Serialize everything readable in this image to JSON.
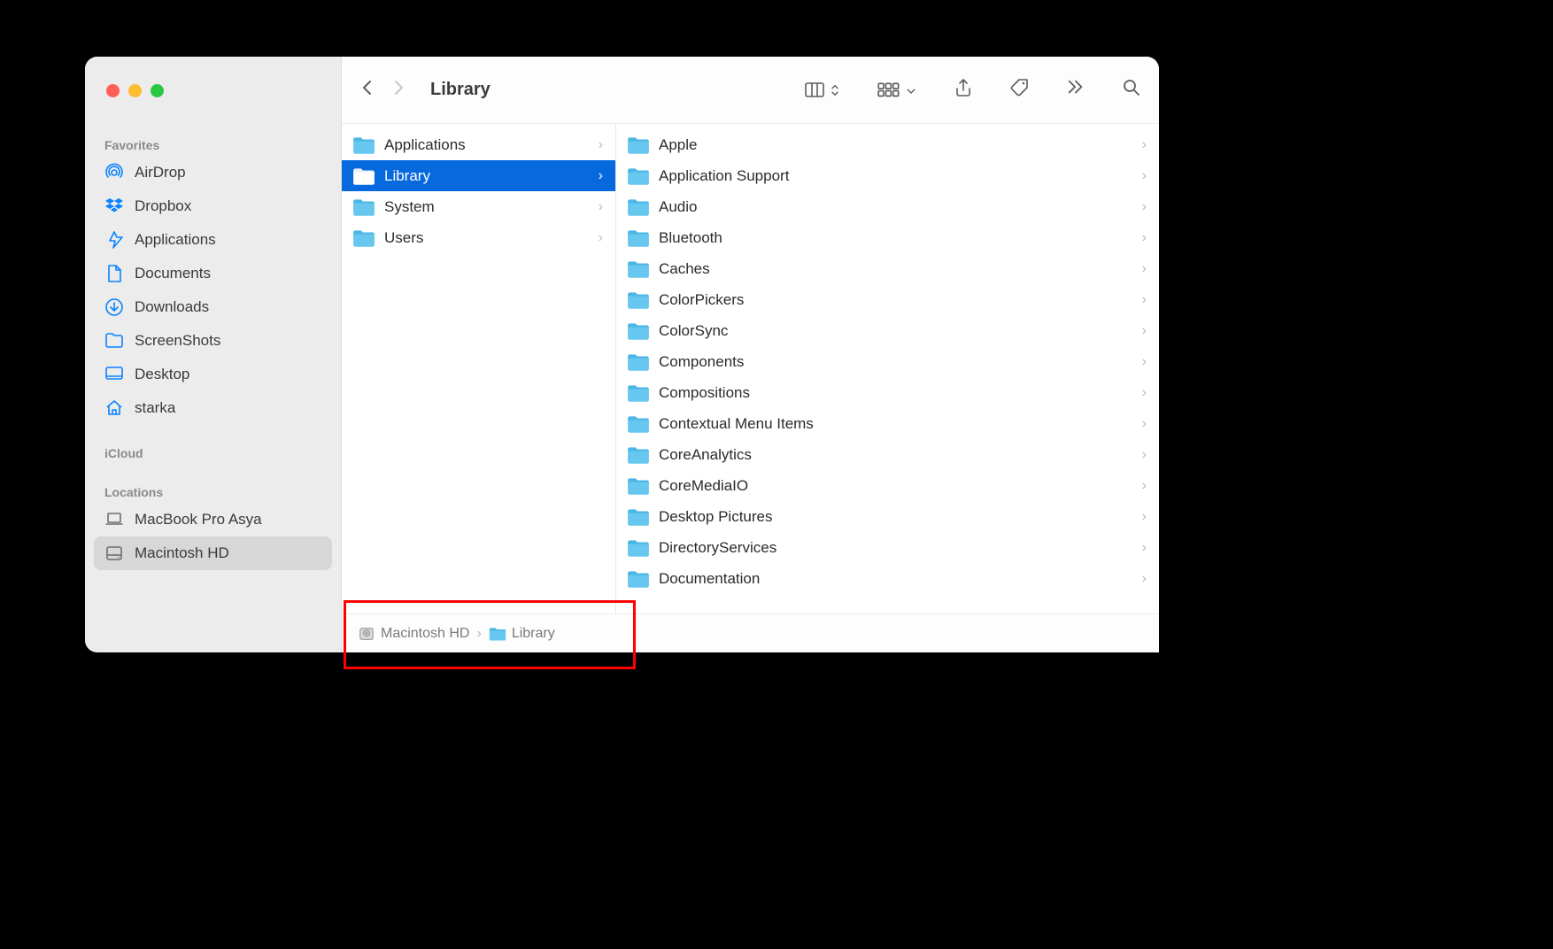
{
  "window": {
    "title": "Library"
  },
  "sidebar": {
    "sections": {
      "favorites": {
        "label": "Favorites",
        "items": [
          {
            "icon": "airdrop",
            "label": "AirDrop"
          },
          {
            "icon": "dropbox",
            "label": "Dropbox"
          },
          {
            "icon": "app",
            "label": "Applications"
          },
          {
            "icon": "doc",
            "label": "Documents"
          },
          {
            "icon": "download",
            "label": "Downloads"
          },
          {
            "icon": "folder",
            "label": "ScreenShots"
          },
          {
            "icon": "desktop",
            "label": "Desktop"
          },
          {
            "icon": "home",
            "label": "starka"
          }
        ]
      },
      "icloud": {
        "label": "iCloud",
        "items": []
      },
      "locations": {
        "label": "Locations",
        "items": [
          {
            "icon": "laptop",
            "label": "MacBook Pro Asya",
            "gray": true
          },
          {
            "icon": "disk",
            "label": "Macintosh HD",
            "gray": true,
            "selected": true
          }
        ]
      }
    }
  },
  "columns": {
    "col1": [
      {
        "label": "Applications"
      },
      {
        "label": "Library",
        "selected": true
      },
      {
        "label": "System"
      },
      {
        "label": "Users"
      }
    ],
    "col2": [
      {
        "label": "Apple"
      },
      {
        "label": "Application Support"
      },
      {
        "label": "Audio"
      },
      {
        "label": "Bluetooth"
      },
      {
        "label": "Caches"
      },
      {
        "label": "ColorPickers"
      },
      {
        "label": "ColorSync"
      },
      {
        "label": "Components"
      },
      {
        "label": "Compositions"
      },
      {
        "label": "Contextual Menu Items"
      },
      {
        "label": "CoreAnalytics"
      },
      {
        "label": "CoreMediaIO"
      },
      {
        "label": "Desktop Pictures"
      },
      {
        "label": "DirectoryServices"
      },
      {
        "label": "Documentation"
      }
    ]
  },
  "pathbar": {
    "items": [
      {
        "icon": "hdd",
        "label": "Macintosh HD"
      },
      {
        "icon": "folder",
        "label": "Library"
      }
    ]
  }
}
